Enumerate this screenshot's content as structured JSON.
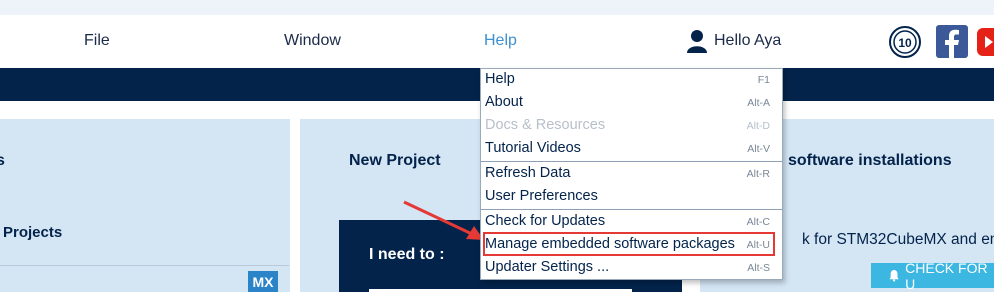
{
  "menubar": {
    "items": [
      {
        "label": "File"
      },
      {
        "label": "Window"
      },
      {
        "label": "Help"
      }
    ],
    "user_greeting": "Hello Aya"
  },
  "badges": {
    "anniversary_text": "10",
    "accent_colors": {
      "facebook": "#3b5998",
      "youtube": "#e62117"
    }
  },
  "panels": {
    "left_title_fragment": "s",
    "left_subtitle_fragment": "Projects",
    "center_title": "New Project",
    "right_title_fragment": "software installations",
    "i_need_to": "I need to :",
    "right_text_fragment": "k for STM32CubeMX and emb",
    "mx_badge": "MX",
    "check_button": "CHECK FOR U"
  },
  "help_menu": {
    "items": [
      {
        "label": "Help",
        "shortcut": "F1",
        "enabled": true
      },
      {
        "label": "About",
        "shortcut": "Alt-A",
        "enabled": true
      },
      {
        "label": "Docs & Resources",
        "shortcut": "Alt-D",
        "enabled": false
      },
      {
        "label": "Tutorial Videos",
        "shortcut": "Alt-V",
        "enabled": true
      },
      {
        "label": "Refresh Data",
        "shortcut": "Alt-R",
        "enabled": true
      },
      {
        "label": "User Preferences",
        "shortcut": "",
        "enabled": true
      },
      {
        "label": "Check for Updates",
        "shortcut": "Alt-C",
        "enabled": true
      },
      {
        "label": "Manage embedded software packages",
        "shortcut": "Alt-U",
        "enabled": true
      },
      {
        "label": "Updater Settings ...",
        "shortcut": "Alt-S",
        "enabled": true
      }
    ]
  },
  "colors": {
    "navy": "#03234b",
    "active_menu": "#3c8fd0",
    "highlight_annotation": "#e53935"
  }
}
